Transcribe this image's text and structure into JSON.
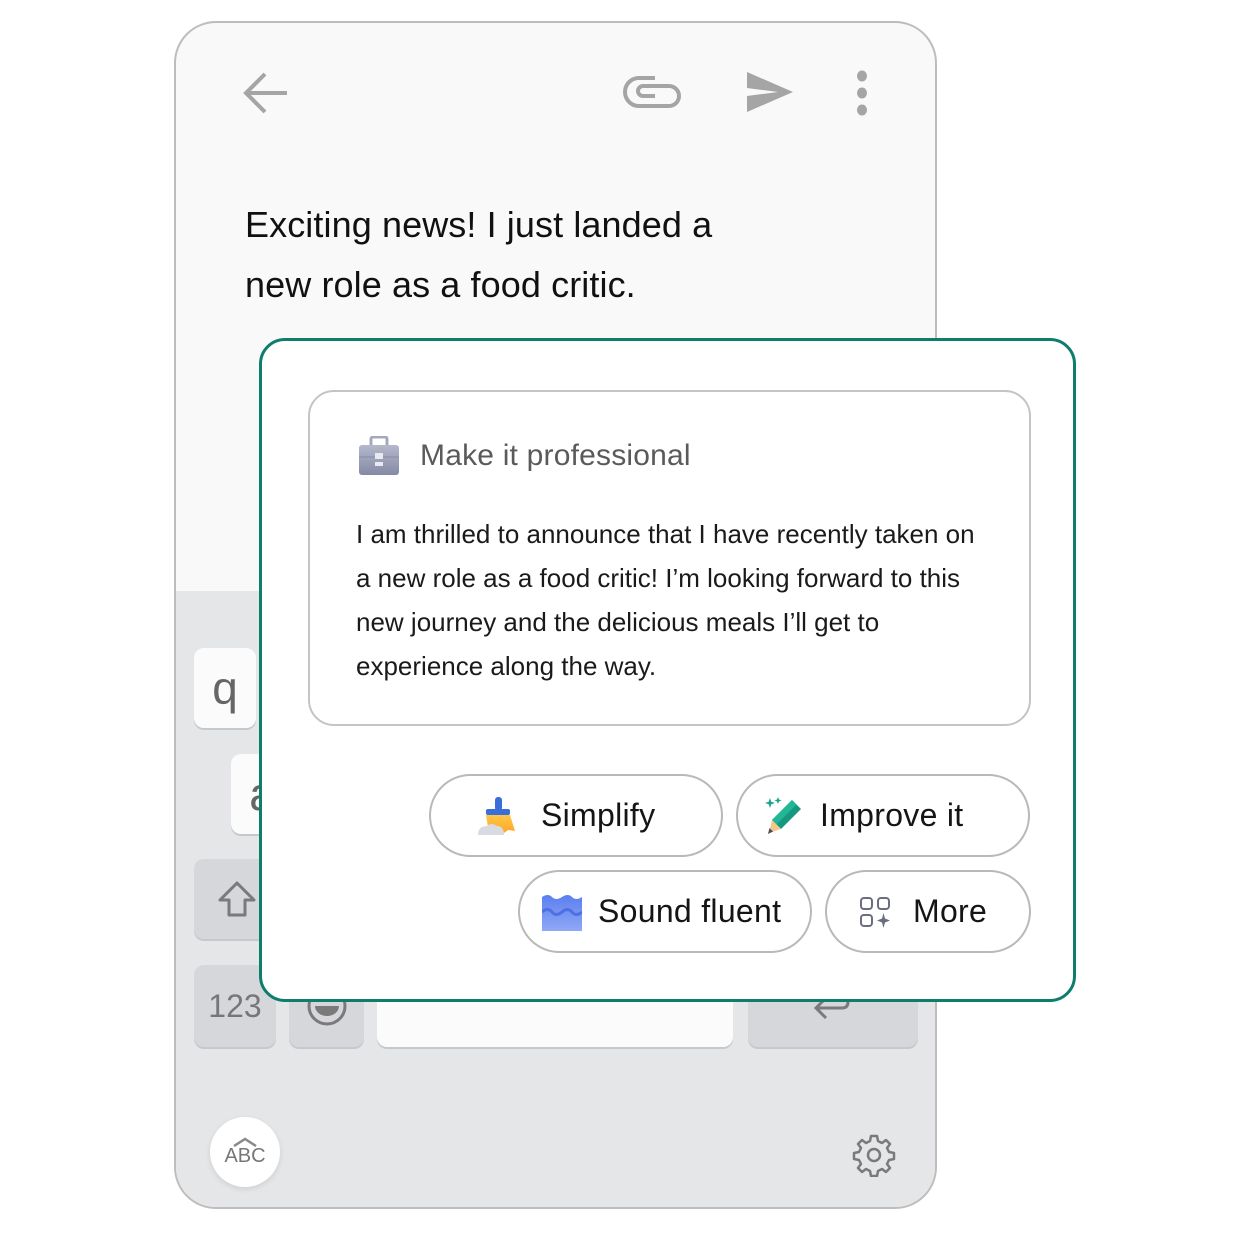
{
  "toolbar": {
    "back_icon": "arrow-left-icon",
    "attach_icon": "paperclip-icon",
    "send_icon": "send-icon",
    "more_icon": "more-vertical-icon"
  },
  "email": {
    "body": "Exciting news! I just landed a new role as a food critic."
  },
  "keyboard": {
    "keys": {
      "q": "q",
      "a": "a",
      "numbers": "123",
      "abc": "ABC"
    },
    "shift_icon": "shift-arrow-icon",
    "emoji_icon": "emoji-icon",
    "enter_icon": "enter-icon",
    "settings_icon": "gear-icon"
  },
  "ai_panel": {
    "accent_color": "#0e7d6b",
    "suggestion": {
      "icon": "briefcase-icon",
      "title": "Make it professional",
      "text": "I am thrilled to announce that I have recently taken on a new role as a food critic! I’m looking forward to this new journey and the delicious meals I’ll get to experience along the way."
    },
    "actions": [
      {
        "label": "Simplify",
        "icon": "broom-icon"
      },
      {
        "label": "Improve it",
        "icon": "sparkle-pencil-icon"
      },
      {
        "label": "Sound fluent",
        "icon": "wave-icon"
      },
      {
        "label": "More",
        "icon": "grid-sparkle-icon"
      }
    ]
  }
}
